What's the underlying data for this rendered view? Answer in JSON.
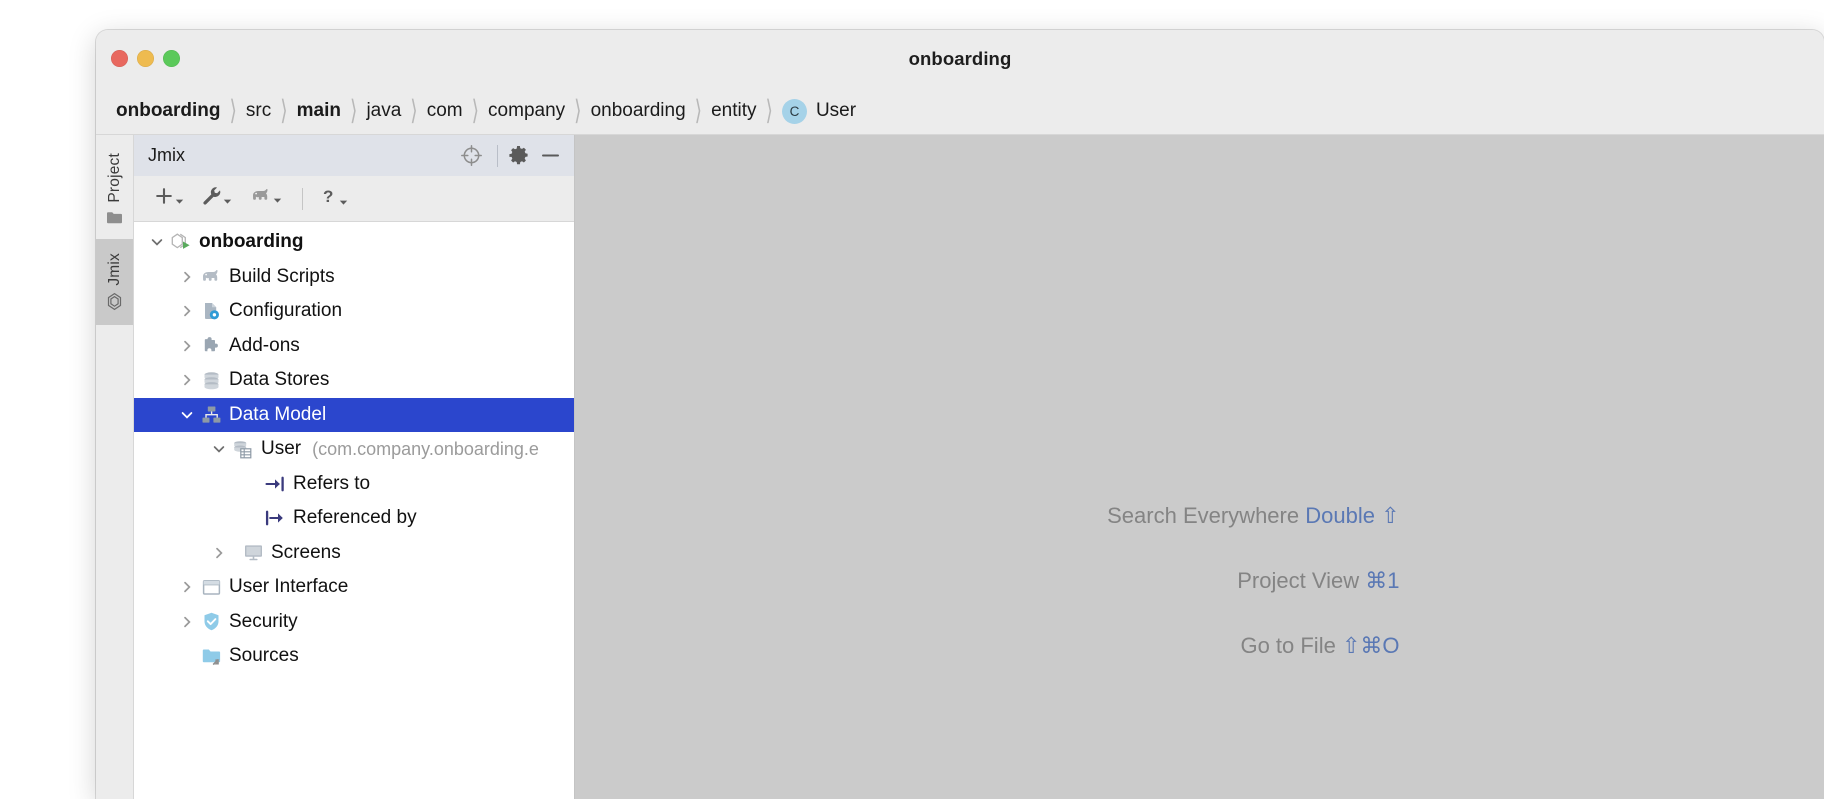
{
  "window": {
    "title": "onboarding",
    "traffic_lights": [
      {
        "name": "close-button",
        "color": "#e8685f"
      },
      {
        "name": "minimize-button",
        "color": "#eebb50"
      },
      {
        "name": "zoom-button",
        "color": "#5bc95a"
      }
    ]
  },
  "breadcrumb": {
    "separator": "〉",
    "items": [
      {
        "label": "onboarding",
        "bold": true,
        "icon": null
      },
      {
        "label": "src",
        "bold": false,
        "icon": null
      },
      {
        "label": "main",
        "bold": true,
        "icon": null
      },
      {
        "label": "java",
        "bold": false,
        "icon": null
      },
      {
        "label": "com",
        "bold": false,
        "icon": null
      },
      {
        "label": "company",
        "bold": false,
        "icon": null
      },
      {
        "label": "onboarding",
        "bold": false,
        "icon": null
      },
      {
        "label": "entity",
        "bold": false,
        "icon": null
      },
      {
        "label": "User",
        "bold": false,
        "icon": "class-badge",
        "badge_text": "C",
        "badge_color": "#a5d2e8"
      }
    ]
  },
  "left_stripe": {
    "items": [
      {
        "label": "Project",
        "icon": "folder-icon",
        "active": false
      },
      {
        "label": "Jmix",
        "icon": "jmix-icon",
        "active": true
      }
    ]
  },
  "tool_window": {
    "title": "Jmix",
    "header_buttons": [
      {
        "name": "locate-icon",
        "glyph": "target"
      },
      {
        "name": "gear-icon",
        "glyph": "gear"
      },
      {
        "name": "minimize-icon",
        "glyph": "minus"
      }
    ],
    "toolbar": [
      {
        "name": "new-button",
        "icon": "plus-icon",
        "has_dropdown": true
      },
      {
        "name": "tools-button",
        "icon": "wrench-icon",
        "has_dropdown": true
      },
      {
        "name": "gradle-button",
        "icon": "elephant-icon",
        "has_dropdown": true
      },
      {
        "name": "separator",
        "icon": "separator",
        "has_dropdown": false
      },
      {
        "name": "help-button",
        "icon": "question-icon",
        "has_dropdown": true
      }
    ]
  },
  "tree": {
    "selection_color": "#2b46cd",
    "nodes": [
      {
        "label": "onboarding",
        "sub": "",
        "depth": 0,
        "twisty": "down",
        "icon": "jmix-project-icon",
        "bold": true,
        "selected": false
      },
      {
        "label": "Build Scripts",
        "sub": "",
        "depth": 1,
        "twisty": "right",
        "icon": "elephant-icon",
        "bold": false,
        "selected": false
      },
      {
        "label": "Configuration",
        "sub": "",
        "depth": 1,
        "twisty": "right",
        "icon": "configuration-icon",
        "bold": false,
        "selected": false
      },
      {
        "label": "Add-ons",
        "sub": "",
        "depth": 1,
        "twisty": "right",
        "icon": "addon-icon",
        "bold": false,
        "selected": false
      },
      {
        "label": "Data Stores",
        "sub": "",
        "depth": 1,
        "twisty": "right",
        "icon": "database-icon",
        "bold": false,
        "selected": false
      },
      {
        "label": "Data Model",
        "sub": "",
        "depth": 1,
        "twisty": "down",
        "icon": "data-model-icon",
        "bold": false,
        "selected": true
      },
      {
        "label": "User",
        "sub": "(com.company.onboarding.e",
        "depth": 2,
        "twisty": "down",
        "icon": "entity-icon",
        "bold": false,
        "selected": false
      },
      {
        "label": "Refers to",
        "sub": "",
        "depth": 3,
        "twisty": "none",
        "icon": "refers-to-icon",
        "bold": false,
        "selected": false
      },
      {
        "label": "Referenced by",
        "sub": "",
        "depth": 3,
        "twisty": "none",
        "icon": "referenced-by-icon",
        "bold": false,
        "selected": false
      },
      {
        "label": "Screens",
        "sub": "",
        "depth": 3,
        "twisty": "right",
        "icon": "screen-icon",
        "bold": false,
        "selected": false
      },
      {
        "label": "User Interface",
        "sub": "",
        "depth": 1,
        "twisty": "right",
        "icon": "ui-icon",
        "bold": false,
        "selected": false
      },
      {
        "label": "Security",
        "sub": "",
        "depth": 1,
        "twisty": "right",
        "icon": "shield-icon",
        "bold": false,
        "selected": false
      },
      {
        "label": "Sources",
        "sub": "",
        "depth": 1,
        "twisty": "none",
        "icon": "sources-folder-icon",
        "bold": false,
        "selected": false
      }
    ]
  },
  "editor": {
    "background": "#cbcbcb",
    "hints": [
      {
        "text": "Search Everywhere",
        "shortcut": "Double ⇧"
      },
      {
        "text": "Project View",
        "shortcut": "⌘1"
      },
      {
        "text": "Go to File",
        "shortcut": "⇧⌘O"
      }
    ]
  }
}
